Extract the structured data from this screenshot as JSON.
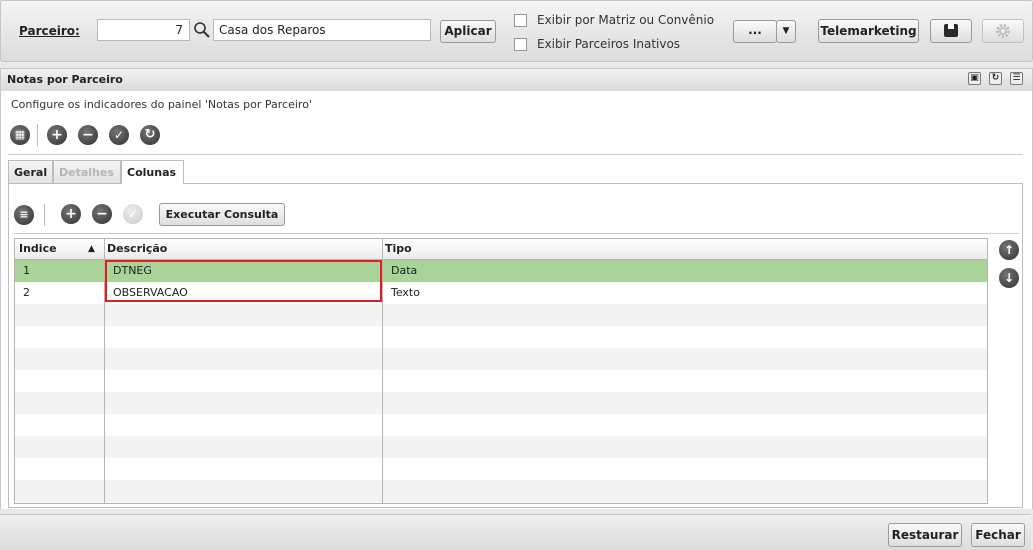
{
  "toolbar": {
    "parceiro_label": "Parceiro:",
    "parceiro_code": "7",
    "parceiro_name": "Casa dos Reparos",
    "apply_label": "Aplicar",
    "checkbox_matriz": "Exibir por Matriz ou Convênio",
    "checkbox_inativos": "Exibir Parceiros Inativos",
    "more_label": "...",
    "telemarketing_label": "Telemarketing"
  },
  "panel": {
    "title": "Notas por Parceiro",
    "description": "Configure os indicadores do painel 'Notas por Parceiro'"
  },
  "tabs": [
    {
      "label": "Geral",
      "state": "normal"
    },
    {
      "label": "Detalhes",
      "state": "disabled"
    },
    {
      "label": "Colunas",
      "state": "active"
    }
  ],
  "subtoolbar": {
    "run_query_label": "Executar Consulta"
  },
  "grid": {
    "columns": [
      "Indice",
      "Descrição",
      "Tipo"
    ],
    "sort_indicator": "▲",
    "rows": [
      {
        "indice": "1",
        "descricao": "DTNEG",
        "tipo": "Data",
        "selected": true
      },
      {
        "indice": "2",
        "descricao": "OBSERVACAO",
        "tipo": "Texto",
        "selected": false
      }
    ]
  },
  "footer": {
    "restore_label": "Restaurar",
    "close_label": "Fechar"
  },
  "colors": {
    "selected_row": "#a8d49a",
    "highlight_box": "#e0201c",
    "stripe": "#f3f3f3"
  }
}
